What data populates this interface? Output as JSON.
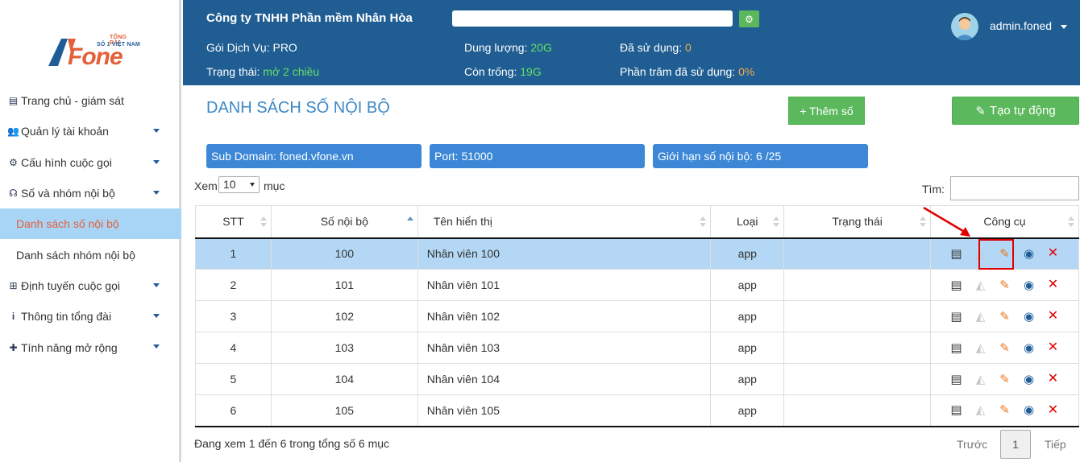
{
  "logo": {
    "line1": "TỔNG ĐÀI",
    "line2": "SỐ 1 VIỆT NAM",
    "brand": "Fone"
  },
  "sidebar": {
    "items": [
      {
        "label": "Trang chủ - giám sát",
        "icon": "clipboard-icon",
        "caret": false
      },
      {
        "label": "Quản lý tài khoản",
        "icon": "users-icon",
        "caret": true
      },
      {
        "label": "Cấu hình cuộc gọi",
        "icon": "gears-icon",
        "caret": true
      },
      {
        "label": "Số và nhóm nội bộ",
        "icon": "headset-icon",
        "caret": true
      },
      {
        "label": "Danh sách số nội bộ",
        "sub": true,
        "active": true
      },
      {
        "label": "Danh sách nhóm nội bộ",
        "sub": true
      },
      {
        "label": "Định tuyến cuộc gọi",
        "icon": "sitemap-icon",
        "caret": true
      },
      {
        "label": "Thông tin tổng đài",
        "icon": "info-icon",
        "caret": true
      },
      {
        "label": "Tính năng mở rộng",
        "icon": "puzzle-icon",
        "caret": true
      }
    ]
  },
  "header": {
    "company": "Công ty TNHH Phần mềm Nhân Hòa",
    "package_label": "Gói Dịch Vụ: ",
    "package_value": "PRO",
    "status_label": "Trạng thái: ",
    "status_value": "mở 2 chiều",
    "capacity_label": "Dung lượng: ",
    "capacity_value": "20G",
    "free_label": "Còn trống: ",
    "free_value": "19G",
    "used_label": "Đã sử dụng: ",
    "used_value": "0",
    "percent_label": "Phần trăm đã sử dụng: ",
    "percent_value": "0%",
    "username": "admin.foned"
  },
  "main": {
    "title": "DANH SÁCH SỐ NỘI BỘ",
    "add_button": "+ Thêm số",
    "auto_button": "Tạo tự động",
    "subdomain_label": "Sub Domain:",
    "subdomain_value": "foned.vfone.vn",
    "port_label": "Port:",
    "port_value": "51000",
    "limit_label": "Giới hạn số nội bộ:",
    "limit_used": "6",
    "limit_total": "/25",
    "show_prefix": "Xem",
    "show_value": "10",
    "show_suffix": "mục",
    "search_label": "Tìm:"
  },
  "table": {
    "columns": [
      "STT",
      "Số nội bộ",
      "Tên hiển thị",
      "Loại",
      "Trạng thái",
      "Công cụ"
    ],
    "rows": [
      {
        "stt": "1",
        "number": "100",
        "name": "Nhân viên 100",
        "type": "app",
        "status": ""
      },
      {
        "stt": "2",
        "number": "101",
        "name": "Nhân viên 101",
        "type": "app",
        "status": ""
      },
      {
        "stt": "3",
        "number": "102",
        "name": "Nhân viên 102",
        "type": "app",
        "status": ""
      },
      {
        "stt": "4",
        "number": "103",
        "name": "Nhân viên 103",
        "type": "app",
        "status": ""
      },
      {
        "stt": "5",
        "number": "104",
        "name": "Nhân viên 104",
        "type": "app",
        "status": ""
      },
      {
        "stt": "6",
        "number": "105",
        "name": "Nhân viên 105",
        "type": "app",
        "status": ""
      }
    ],
    "tool_icons": [
      "clipboard-icon",
      "eraser-icon",
      "pencil-icon",
      "eye-icon",
      "delete-icon"
    ]
  },
  "footer": {
    "info": "Đang xem 1 đến 6 trong tổng số 6 mục",
    "prev": "Trước",
    "current_page": "1",
    "next": "Tiếp"
  },
  "colors": {
    "header_bg": "#1f5d92",
    "accent_blue": "#3c88d6",
    "green_button": "#5cb85c",
    "selected_row": "#b3d7f5",
    "active_menu": "#a8d4f5",
    "highlight_red": "#e00000"
  }
}
